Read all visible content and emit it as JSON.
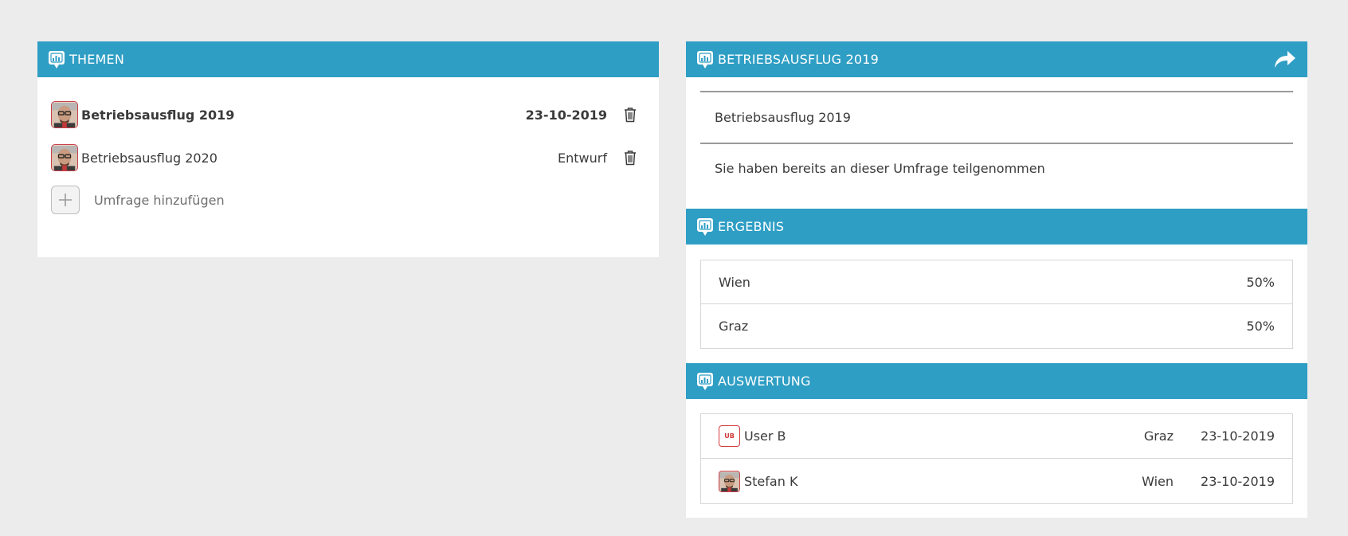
{
  "themen": {
    "header": "THEMEN",
    "topics": [
      {
        "title": "Betriebsausflug 2019",
        "meta": "23-10-2019",
        "bold": true
      },
      {
        "title": "Betriebsausflug 2020",
        "meta": "Entwurf",
        "bold": false
      }
    ],
    "add_label": "Umfrage hinzufügen"
  },
  "detail": {
    "header": "BETRIEBSAUSFLUG 2019",
    "title": "Betriebsausflug 2019",
    "status": "Sie haben bereits an dieser Umfrage teilgenommen"
  },
  "ergebnis": {
    "header": "ERGEBNIS",
    "rows": [
      {
        "label": "Wien",
        "value": "50%"
      },
      {
        "label": "Graz",
        "value": "50%"
      }
    ]
  },
  "auswertung": {
    "header": "AUSWERTUNG",
    "rows": [
      {
        "badge": "UB",
        "user": "User B",
        "city": "Graz",
        "date": "23-10-2019"
      },
      {
        "user": "Stefan K",
        "city": "Wien",
        "date": "23-10-2019"
      }
    ]
  },
  "colors": {
    "header_bg": "#2f9ec4",
    "page_bg": "#ececec",
    "accent_red": "#d23a3a"
  },
  "icons": {
    "header": "chat-chart-icon",
    "share": "share-arrow-icon",
    "delete": "trash-icon",
    "add": "plus-icon"
  }
}
